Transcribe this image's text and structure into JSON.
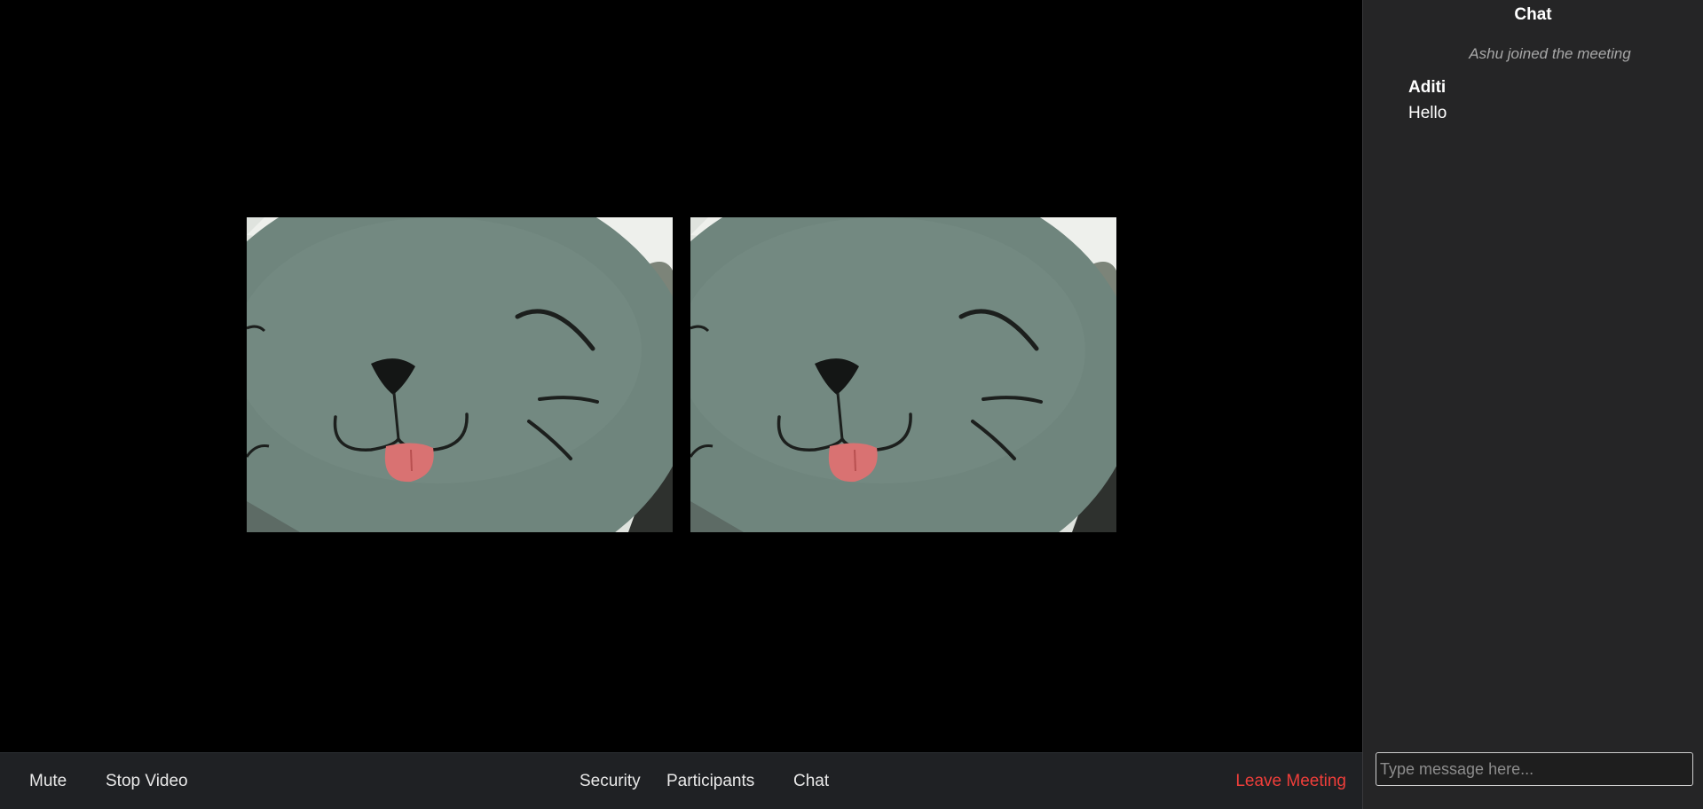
{
  "toolbar": {
    "mute_label": "Mute",
    "stop_video_label": "Stop Video",
    "security_label": "Security",
    "participants_label": "Participants",
    "chat_label": "Chat",
    "leave_label": "Leave Meeting"
  },
  "chat": {
    "title": "Chat",
    "system_message": "Ashu joined the meeting",
    "messages": [
      {
        "author": "Aditi",
        "text": "Hello"
      }
    ],
    "input_placeholder": "Type message here..."
  },
  "colors": {
    "leave_accent": "#ef3e3a",
    "toolbar_bg": "#1f2124",
    "chat_bg": "#252526"
  },
  "video_tiles": [
    {
      "icon": "plush-cat-face"
    },
    {
      "icon": "plush-cat-face"
    }
  ]
}
